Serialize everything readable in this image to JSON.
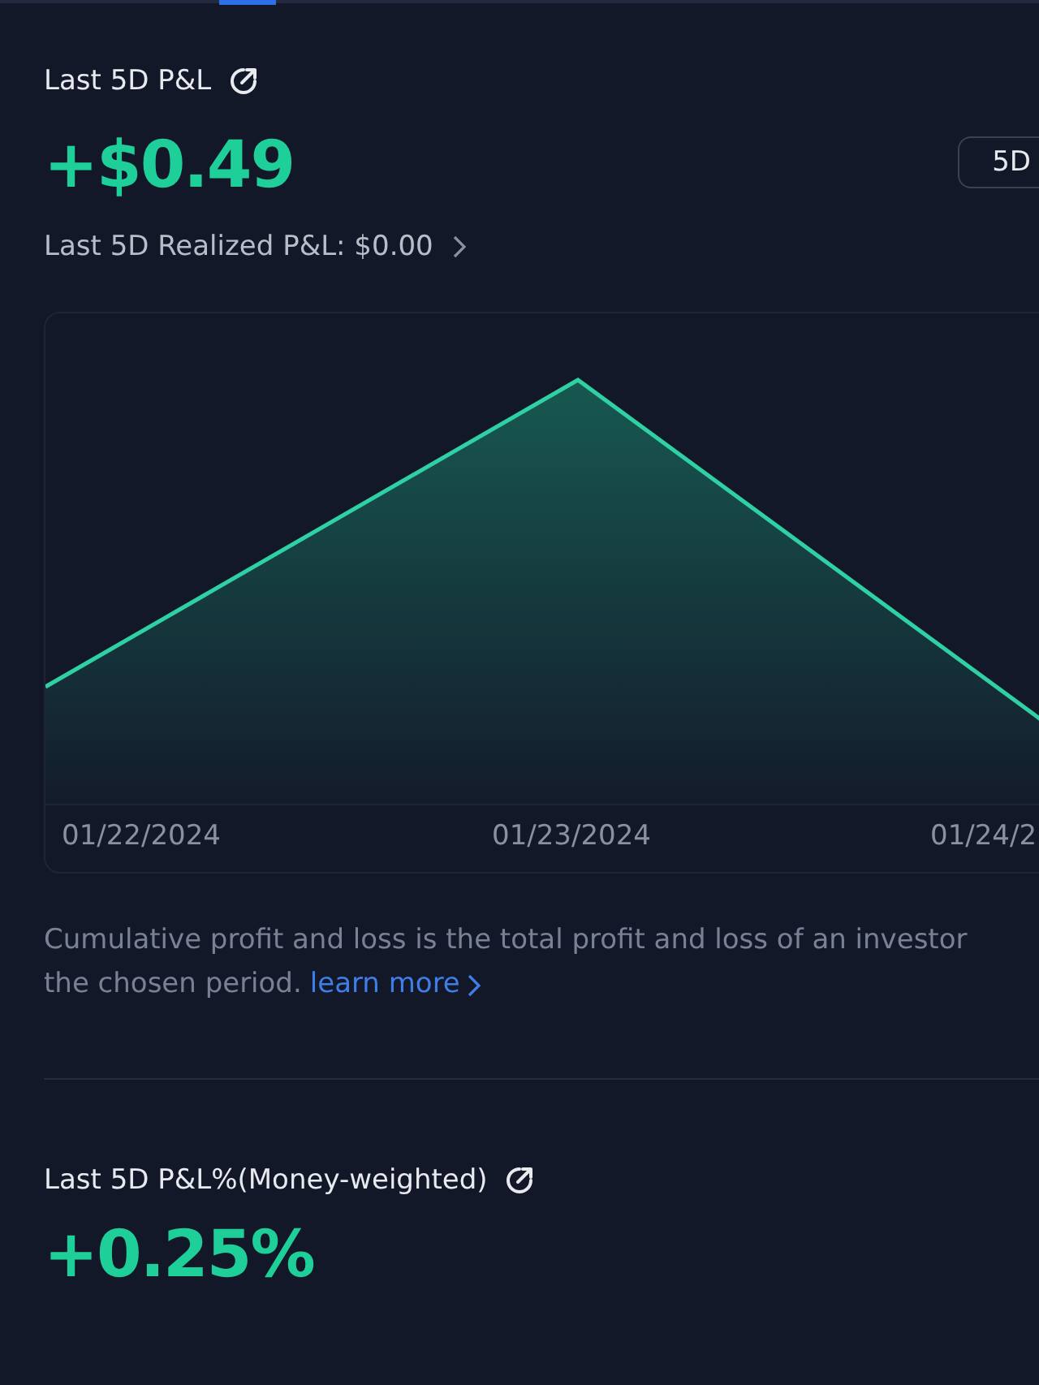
{
  "tab_indicator": {
    "selected": true
  },
  "pnl": {
    "title": "Last 5D P&L",
    "value": "+$0.49",
    "period_button": "5D",
    "realized": "Last 5D Realized P&L: $0.00"
  },
  "chart": {
    "x_labels": [
      "01/22/2024",
      "01/23/2024",
      "01/24/2"
    ]
  },
  "description": {
    "line_1": "Cumulative profit and loss is the total profit and loss of an investor",
    "line_2": "the chosen period.",
    "link": "learn more"
  },
  "pnl_percent": {
    "title": "Last 5D P&L%(Money-weighted)",
    "value": "+0.25%"
  }
}
